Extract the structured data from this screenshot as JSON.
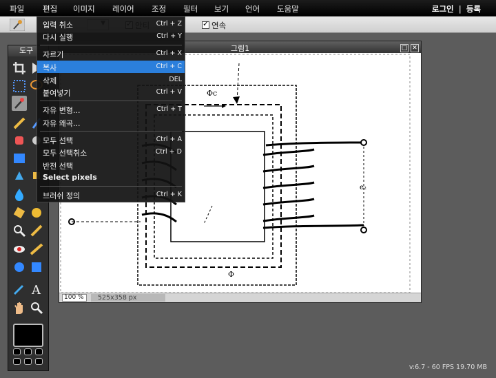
{
  "menubar": {
    "items": [
      "파일",
      "편집",
      "이미지",
      "레이어",
      "조정",
      "필터",
      "보기",
      "언어",
      "도움말"
    ],
    "login": "로그인",
    "separator": "|",
    "register": "등록"
  },
  "options": {
    "antialias_label": "안티",
    "contiguous_label": "연속"
  },
  "toolbox": {
    "title": "도구"
  },
  "image_window": {
    "title": "그림1",
    "zoom": "100 %",
    "dimensions": "525x358 px"
  },
  "edit_menu": {
    "items": [
      {
        "label": "입력 취소",
        "shortcut": "Ctrl + Z"
      },
      {
        "label": "다시 실행",
        "shortcut": "Ctrl + Y"
      },
      {
        "label": "자르기",
        "shortcut": "Ctrl + X"
      },
      {
        "label": "복사",
        "shortcut": "Ctrl + C",
        "selected": true
      },
      {
        "label": "삭제",
        "shortcut": "DEL"
      },
      {
        "label": "붙여넣기",
        "shortcut": "Ctrl + V"
      },
      {
        "label": "자유 변형...",
        "shortcut": "Ctrl + T"
      },
      {
        "label": "자유 왜곡...",
        "shortcut": ""
      },
      {
        "label": "모두 선택",
        "shortcut": "Ctrl + A"
      },
      {
        "label": "모두 선택취소",
        "shortcut": "Ctrl + D"
      },
      {
        "label": "반전 선택",
        "shortcut": ""
      },
      {
        "label": "Select pixels",
        "shortcut": ""
      },
      {
        "label": "브러쉬 정의",
        "shortcut": "Ctrl + K"
      }
    ]
  },
  "diagram_labels": {
    "phi_c": "Φc",
    "phi": "Φ",
    "e": "e₂"
  },
  "status": {
    "version": "v:6.7 - 60 FPS 19.70 MB"
  },
  "colors": {
    "menu_highlight": "#2b7fdc",
    "background": "#5c5c5c"
  }
}
